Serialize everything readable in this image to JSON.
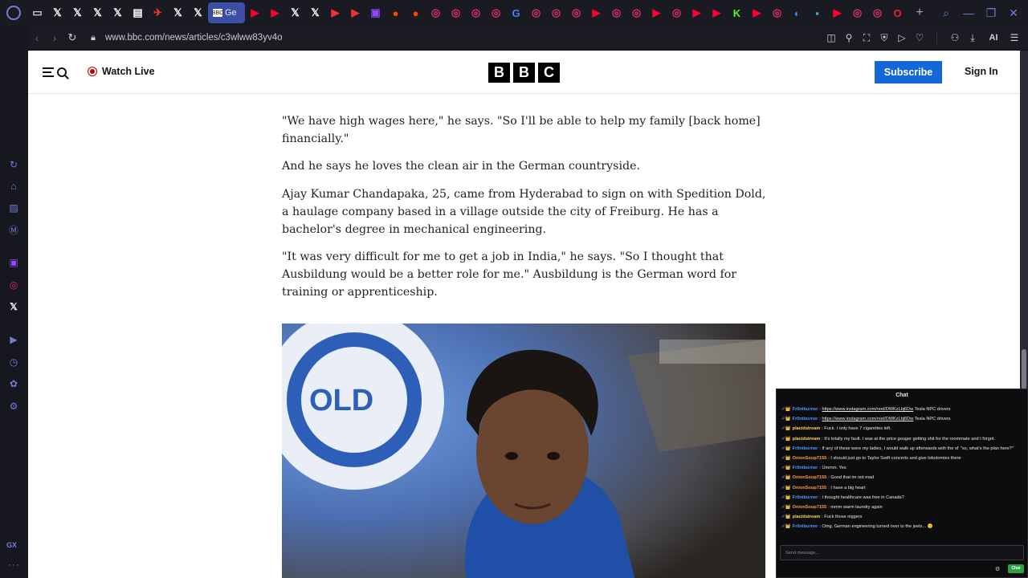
{
  "browser": {
    "tabs": [
      {
        "icon": "gamepad-icon",
        "color": "#cfd0d8",
        "glyph": "▭"
      },
      {
        "icon": "x-icon",
        "color": "#ffffff",
        "glyph": "𝕏"
      },
      {
        "icon": "x-icon",
        "color": "#ffffff",
        "glyph": "𝕏"
      },
      {
        "icon": "x-icon",
        "color": "#ffffff",
        "glyph": "𝕏"
      },
      {
        "icon": "x-icon",
        "color": "#ffffff",
        "glyph": "𝕏"
      },
      {
        "icon": "news-icon",
        "color": "#ffffff",
        "glyph": "▤"
      },
      {
        "icon": "plane-icon",
        "color": "#e33",
        "glyph": "✈"
      },
      {
        "icon": "x-icon",
        "color": "#ffffff",
        "glyph": "𝕏"
      },
      {
        "icon": "x-icon",
        "color": "#ffffff",
        "glyph": "𝕏"
      }
    ],
    "active_tab_label": "Ge",
    "tabs_after": [
      {
        "icon": "youtube-icon",
        "color": "#ff0033",
        "glyph": "▶"
      },
      {
        "icon": "youtube-icon",
        "color": "#ff0033",
        "glyph": "▶"
      },
      {
        "icon": "x-icon",
        "color": "#ffffff",
        "glyph": "𝕏"
      },
      {
        "icon": "x-icon",
        "color": "#ffffff",
        "glyph": "𝕏"
      },
      {
        "icon": "play-icon",
        "color": "#e33",
        "glyph": "▶"
      },
      {
        "icon": "play-icon",
        "color": "#e33",
        "glyph": "▶"
      },
      {
        "icon": "twitch-icon",
        "color": "#9146ff",
        "glyph": "▣"
      },
      {
        "icon": "reddit-icon",
        "color": "#ff4500",
        "glyph": "●"
      },
      {
        "icon": "reddit-icon",
        "color": "#ff4500",
        "glyph": "●"
      },
      {
        "icon": "instagram-icon",
        "color": "#e1306c",
        "glyph": "◎"
      },
      {
        "icon": "instagram-icon",
        "color": "#e1306c",
        "glyph": "◎"
      },
      {
        "icon": "instagram-icon",
        "color": "#e1306c",
        "glyph": "◎"
      },
      {
        "icon": "instagram-icon",
        "color": "#e1306c",
        "glyph": "◎"
      },
      {
        "icon": "google-icon",
        "color": "#4285f4",
        "glyph": "G"
      },
      {
        "icon": "instagram-icon",
        "color": "#e1306c",
        "glyph": "◎"
      },
      {
        "icon": "instagram-icon",
        "color": "#e1306c",
        "glyph": "◎"
      },
      {
        "icon": "instagram-icon",
        "color": "#e1306c",
        "glyph": "◎"
      },
      {
        "icon": "youtube-icon",
        "color": "#ff0033",
        "glyph": "▶"
      },
      {
        "icon": "instagram-icon",
        "color": "#e1306c",
        "glyph": "◎"
      },
      {
        "icon": "instagram-icon",
        "color": "#e1306c",
        "glyph": "◎"
      },
      {
        "icon": "youtube-icon",
        "color": "#ff0033",
        "glyph": "▶"
      },
      {
        "icon": "instagram-icon",
        "color": "#e1306c",
        "glyph": "◎"
      },
      {
        "icon": "youtube-icon",
        "color": "#ff0033",
        "glyph": "▶"
      },
      {
        "icon": "youtube-icon",
        "color": "#ff0033",
        "glyph": "▶"
      },
      {
        "icon": "kick-icon",
        "color": "#53fc18",
        "glyph": "K"
      },
      {
        "icon": "youtube-icon",
        "color": "#ff0033",
        "glyph": "▶"
      },
      {
        "icon": "instagram-icon",
        "color": "#e1306c",
        "glyph": "◎"
      },
      {
        "icon": "edge-icon",
        "color": "#3b82f6",
        "glyph": "◐"
      },
      {
        "icon": "app-icon",
        "color": "#4aa3df",
        "glyph": "▪"
      },
      {
        "icon": "youtube-icon",
        "color": "#ff0033",
        "glyph": "▶"
      },
      {
        "icon": "instagram-icon",
        "color": "#e1306c",
        "glyph": "◎"
      },
      {
        "icon": "instagram-icon",
        "color": "#e1306c",
        "glyph": "◎"
      },
      {
        "icon": "opera-icon",
        "color": "#ff1b2d",
        "glyph": "O"
      }
    ],
    "url": "www.bbc.com/news/articles/c3wlww83yv4o",
    "ai_label": "AI",
    "sidebar_gx": "GX"
  },
  "header": {
    "watch_live": "Watch Live",
    "logo_letters": [
      "B",
      "B",
      "C"
    ],
    "subscribe": "Subscribe",
    "sign_in": "Sign In"
  },
  "article": {
    "paragraphs": [
      "\"We have high wages here,\" he says. \"So I'll be able to help my family [back home] financially.\"",
      "And he says he loves the clean air in the German countryside.",
      "Ajay Kumar Chandapaka, 25, came from Hyderabad to sign on with Spedition Dold, a haulage company based in a village outside the city of Freiburg. He has a bachelor's degree in mechanical engineering.",
      "\"It was very difficult for me to get a job in India,\" he says. \"So I thought that Ausbildung would be a better role for me.\" Ausbildung is the German word for training or apprenticeship."
    ],
    "photo_sign_text": "EDITION DOLD LOGISTIK"
  },
  "chat": {
    "title": "Chat",
    "messages": [
      {
        "user": "Fr0ntburner",
        "color": "#4a9cff",
        "text": "",
        "link": "https://www.instagram.com/reel/DWKzLbj6Dw",
        "after": " Tesla NPC drivers"
      },
      {
        "user": "Fr0ntburner",
        "color": "#4a9cff",
        "text": "",
        "link": "https://www.instagram.com/reel/DWKzLbj6Dw",
        "after": " Tesla NPC drivers"
      },
      {
        "user": "placidstream",
        "color": "#ffd84a",
        "text": "Fuck. I only have 7 cigarettes left."
      },
      {
        "user": "placidstream",
        "color": "#ffd84a",
        "text": "It's totally my fault. I was at the price gouger getting shit for the roommate and I forgot."
      },
      {
        "user": "Fr0ntburner",
        "color": "#4a9cff",
        "text": "If any of these were my ladies, I would walk up afterwards with the ol' \"so, what's the plan here?\""
      },
      {
        "user": "OnionSoup7155",
        "color": "#ff9a3c",
        "text": "I should just go to Taylor Swift concerts and give lobotomies there"
      },
      {
        "user": "Fr0ntburner",
        "color": "#4a9cff",
        "text": "Ummm. Yes"
      },
      {
        "user": "OnionSoup7155",
        "color": "#ff9a3c",
        "text": "Good that im not mad"
      },
      {
        "user": "OnionSoup7155",
        "color": "#ff9a3c",
        "text": "I have a big heart"
      },
      {
        "user": "Fr0ntburner",
        "color": "#4a9cff",
        "text": "I thought healthcare was free in Canada?"
      },
      {
        "user": "OnionSoup7155",
        "color": "#ff9a3c",
        "text": "mmm warm laundry again"
      },
      {
        "user": "placidstream",
        "color": "#ffd84a",
        "text": "Fuck those niggers"
      },
      {
        "user": "Fr0ntburner",
        "color": "#4a9cff",
        "text": "Omg. German engineering turned over to the jeets... 😊"
      }
    ],
    "input_placeholder": "Send message...",
    "send_label": "Chat"
  }
}
